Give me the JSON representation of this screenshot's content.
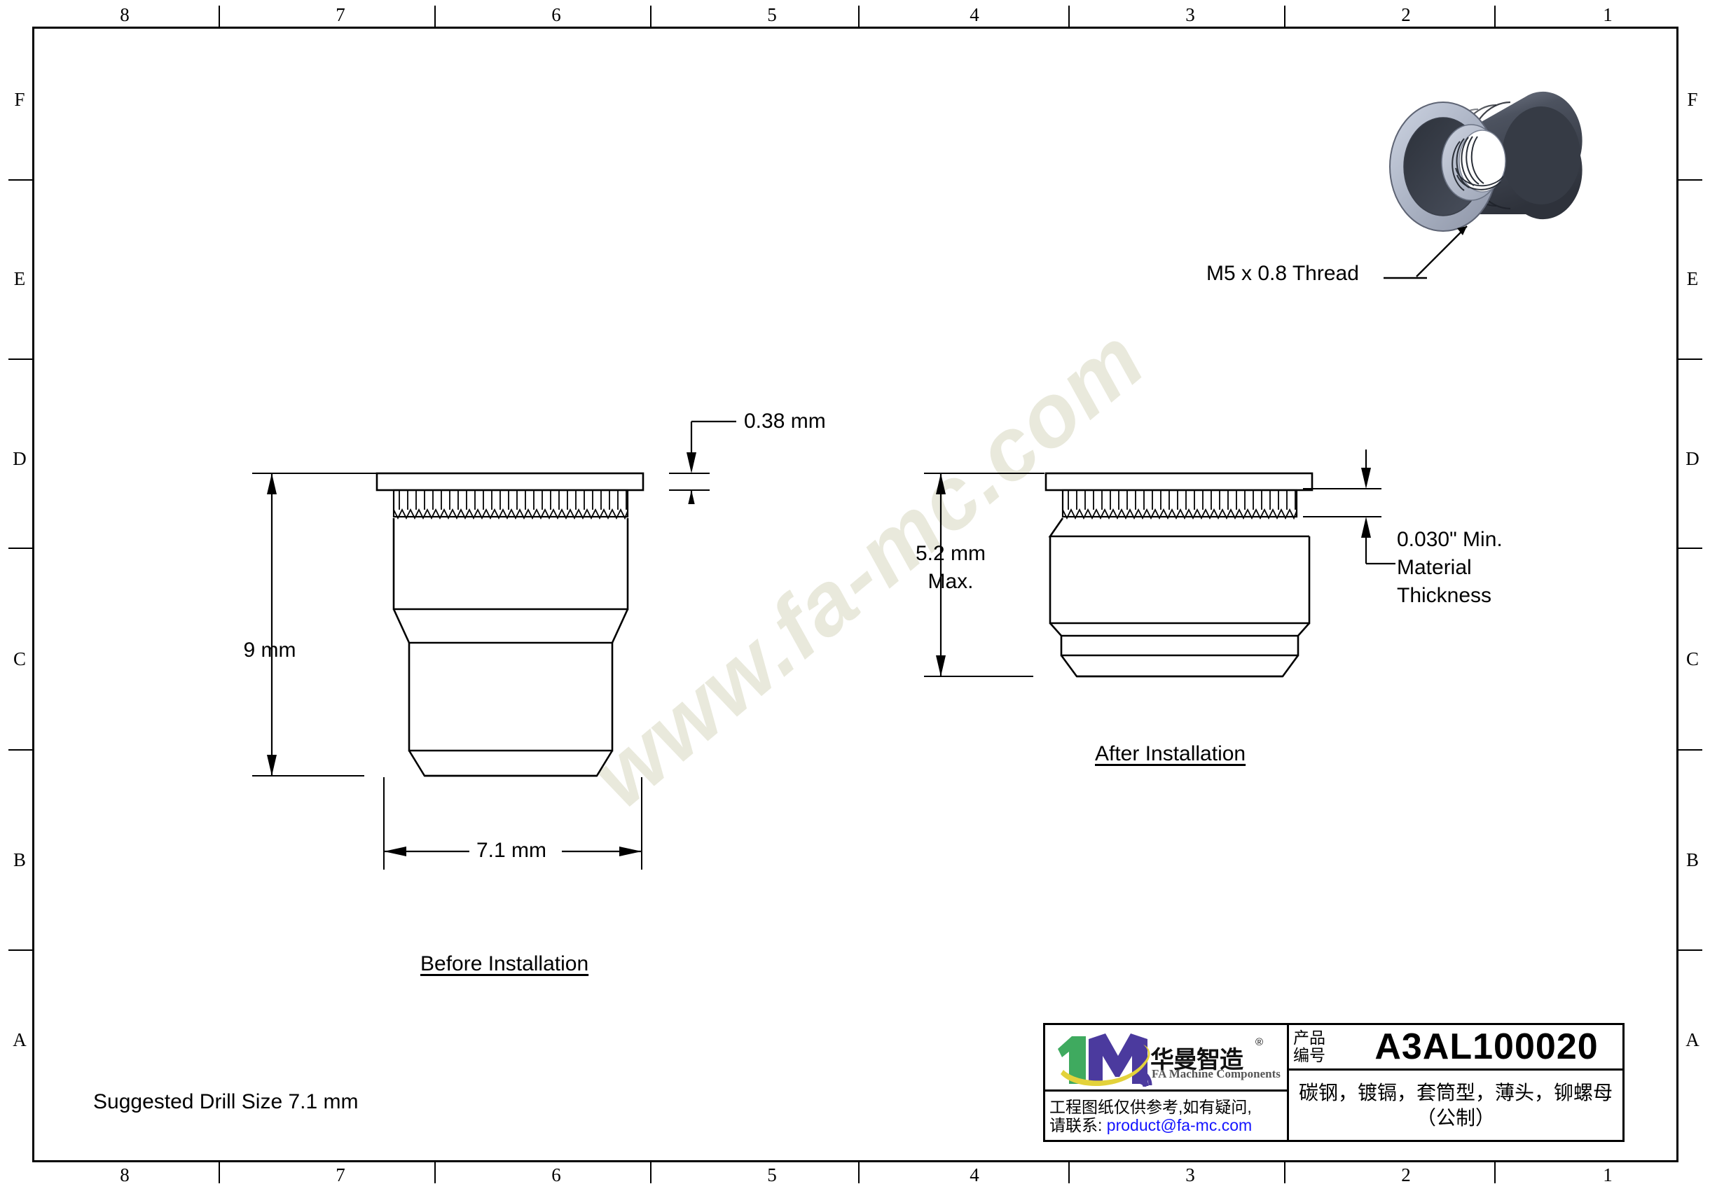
{
  "sheet": {
    "zone_columns": [
      "8",
      "7",
      "6",
      "5",
      "4",
      "3",
      "2",
      "1"
    ],
    "zone_rows": [
      "F",
      "E",
      "D",
      "C",
      "B",
      "A"
    ]
  },
  "watermark": {
    "text": "www.fa-mc.com",
    "color": "#e9e9dc"
  },
  "callouts": {
    "thread": "M5 x 0.8 Thread",
    "flange_thickness": "0.38 mm",
    "overall_length": "9 mm",
    "body_diameter": "7.1 mm",
    "installed_height_line1": "5.2 mm",
    "installed_height_line2": "Max.",
    "material_thickness_line1": "0.030\" Min.",
    "material_thickness_line2": "Material",
    "material_thickness_line3": "Thickness"
  },
  "view_labels": {
    "before": "Before Installation",
    "after": "After Installation"
  },
  "notes": {
    "drill_size": "Suggested Drill Size 7.1 mm"
  },
  "title_block": {
    "logo": {
      "numeral": "1",
      "letter": "M",
      "chinese": "华曼智造",
      "registered": "®",
      "english": "FA Machine Components",
      "green": "#3faa5f",
      "purple": "#4b3a9e",
      "yellow": "#e3d23b"
    },
    "contact_line1": "工程图纸仅供参考,如有疑问,",
    "contact_line2_prefix": "请联系: ",
    "contact_email": "product@fa-mc.com",
    "part_number_label_line1": "产品",
    "part_number_label_line2": "编号",
    "part_number": "A3AL100020",
    "description_line1": "碳钢，镀镉，套筒型，薄头，铆螺母",
    "description_line2": "（公制）"
  },
  "part_3d": {
    "colors": {
      "dark": "#3a3f4a",
      "mid": "#6d7585",
      "light": "#b8bfcf",
      "pale": "#d7dce7",
      "bore": "#ffffff"
    }
  }
}
